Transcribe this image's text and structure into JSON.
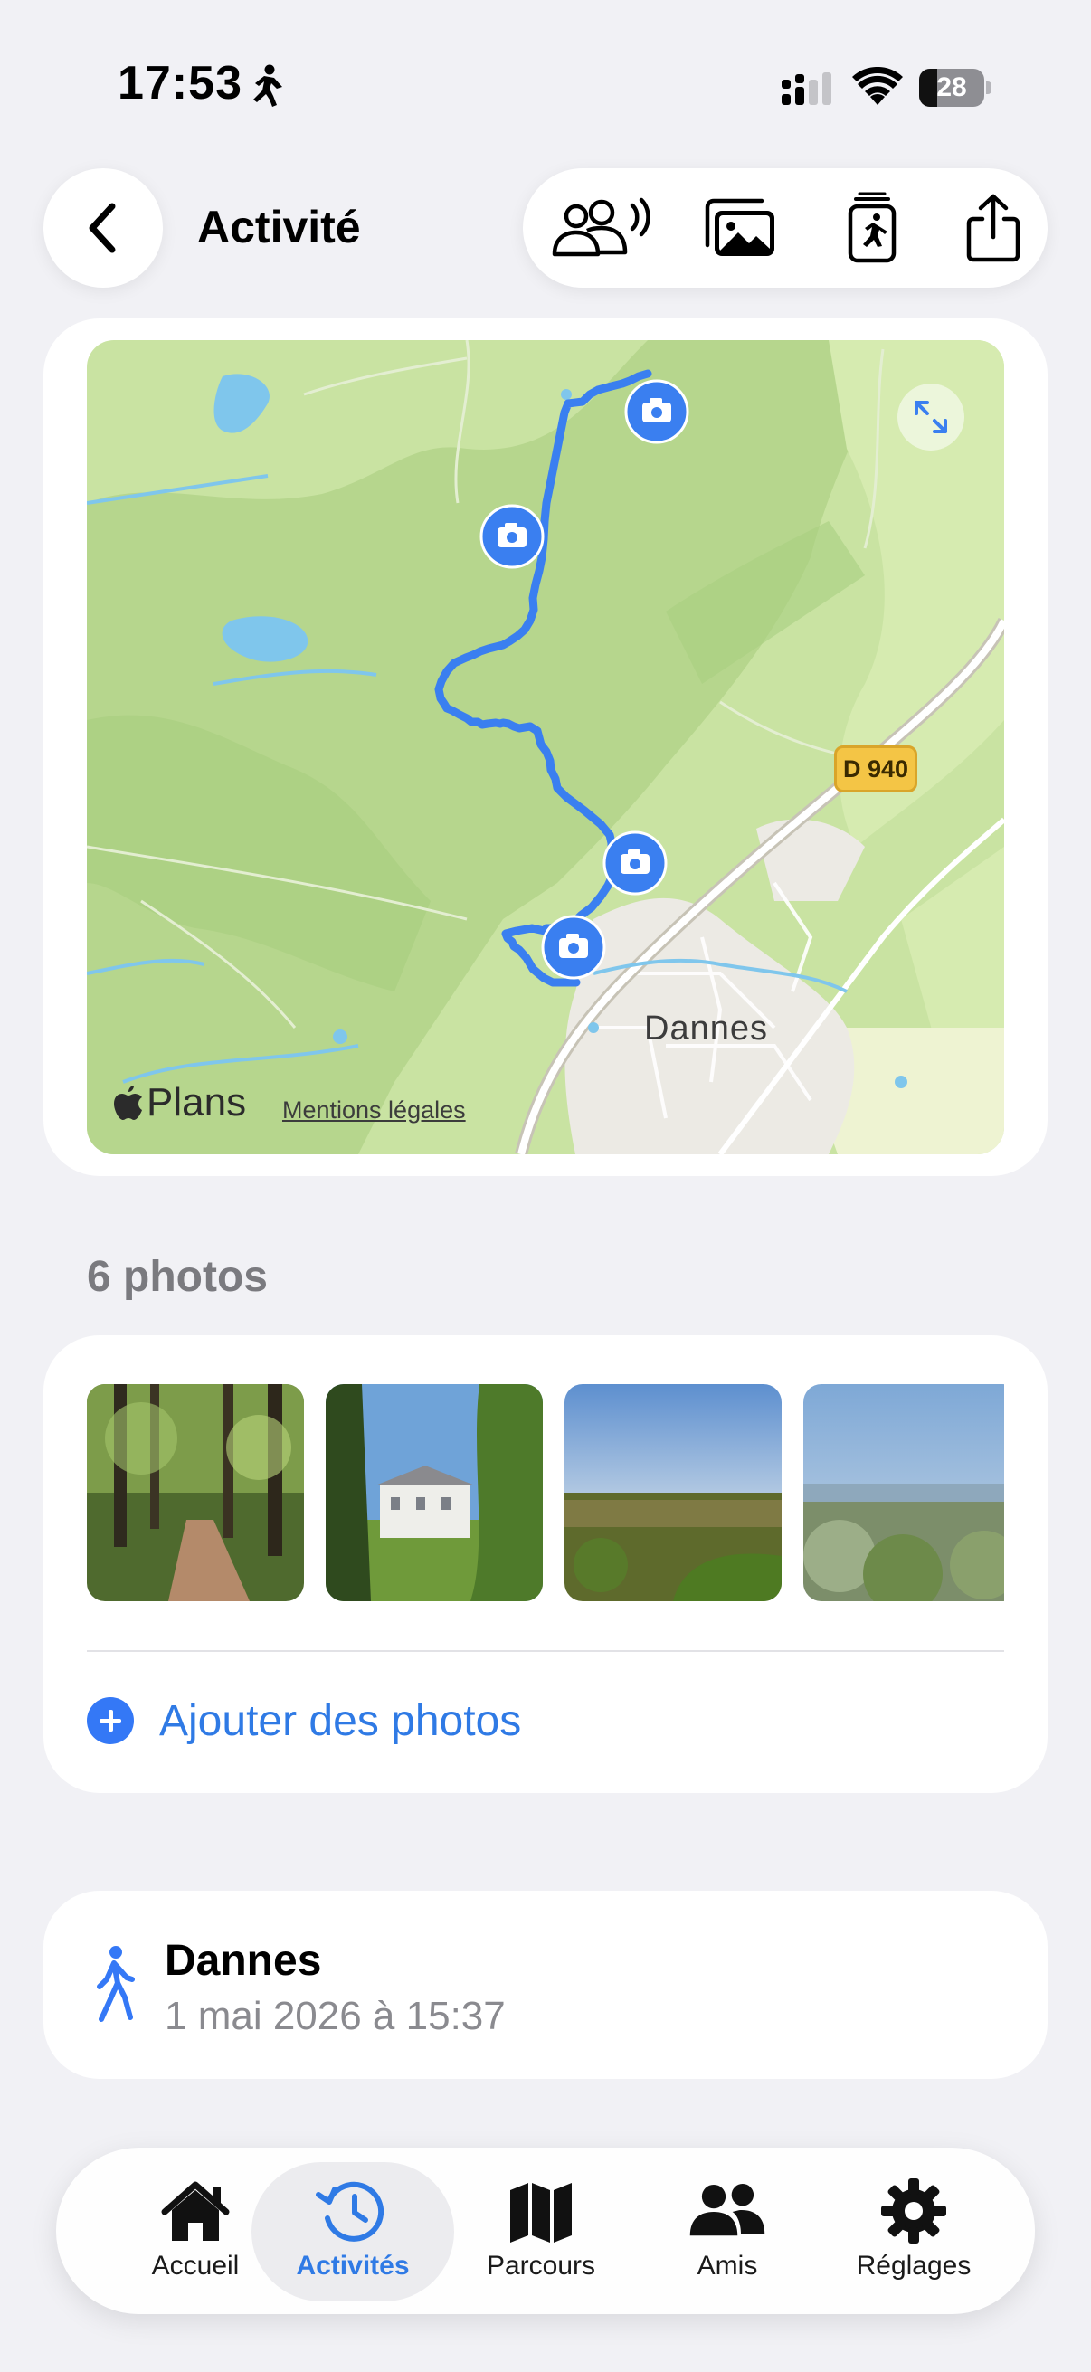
{
  "status_bar": {
    "time": "17:53",
    "battery": "28",
    "battery_level": 0.28
  },
  "header": {
    "title": "Activité"
  },
  "map": {
    "road_label": "D 940",
    "town_label": "Dannes",
    "provider": "Plans",
    "legal": "Mentions légales",
    "route_color": "#3a7ff0",
    "photo_markers": 4
  },
  "photos": {
    "heading": "6 photos",
    "add_label": "Ajouter des photos"
  },
  "summary": {
    "title": "Dannes",
    "date": "1 mai 2026 à 15:37"
  },
  "tab_bar": {
    "items": [
      {
        "label": "Accueil",
        "icon": "house-icon"
      },
      {
        "label": "Activités",
        "icon": "history-icon",
        "active": true
      },
      {
        "label": "Parcours",
        "icon": "map-icon"
      },
      {
        "label": "Amis",
        "icon": "people-icon"
      },
      {
        "label": "Réglages",
        "icon": "gear-icon"
      }
    ]
  },
  "colors": {
    "accent": "#2f7ae5",
    "background": "#f1f1f5"
  }
}
